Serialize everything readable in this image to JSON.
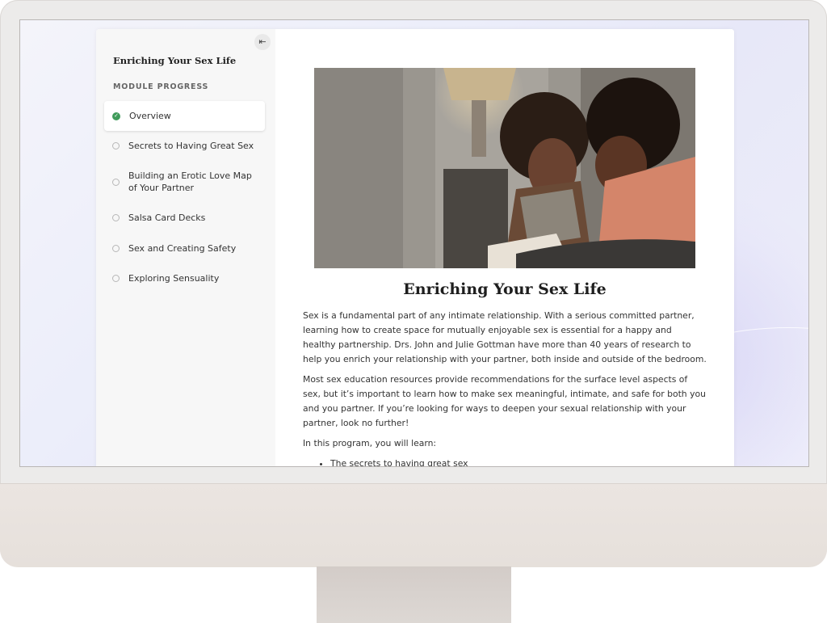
{
  "sidebar": {
    "collapse_icon": "collapse-left-icon",
    "course_title": "Enriching Your Sex Life",
    "module_heading": "MODULE PROGRESS",
    "lessons": [
      {
        "label": "Overview",
        "status": "complete"
      },
      {
        "label": "Secrets to Having Great Sex",
        "status": "incomplete"
      },
      {
        "label": "Building an Erotic Love Map of Your Partner",
        "status": "incomplete"
      },
      {
        "label": "Salsa Card Decks",
        "status": "incomplete"
      },
      {
        "label": "Sex and Creating Safety",
        "status": "incomplete"
      },
      {
        "label": "Exploring Sensuality",
        "status": "incomplete"
      }
    ]
  },
  "main": {
    "title": "Enriching Your Sex Life",
    "paragraphs": [
      "Sex is a fundamental part of any intimate relationship. With a serious committed partner, learning how to create space for mutually enjoyable sex is essential for a happy and healthy partnership. Drs. John and Julie Gottman have more than 40 years of research to help you enrich your relationship with your partner, both inside and outside of the bedroom.",
      "Most sex education resources provide recommendations for the surface level aspects of sex, but it’s important to learn how to make sex meaningful, intimate, and safe for both you and you partner. If you’re looking for ways to deepen your sexual relationship with your partner, look no further!",
      "In this program, you will learn:"
    ],
    "bullets": [
      "The secrets to having great sex"
    ]
  },
  "colors": {
    "complete": "#3f9b5a",
    "sidebar_bg": "#f7f7f7"
  }
}
